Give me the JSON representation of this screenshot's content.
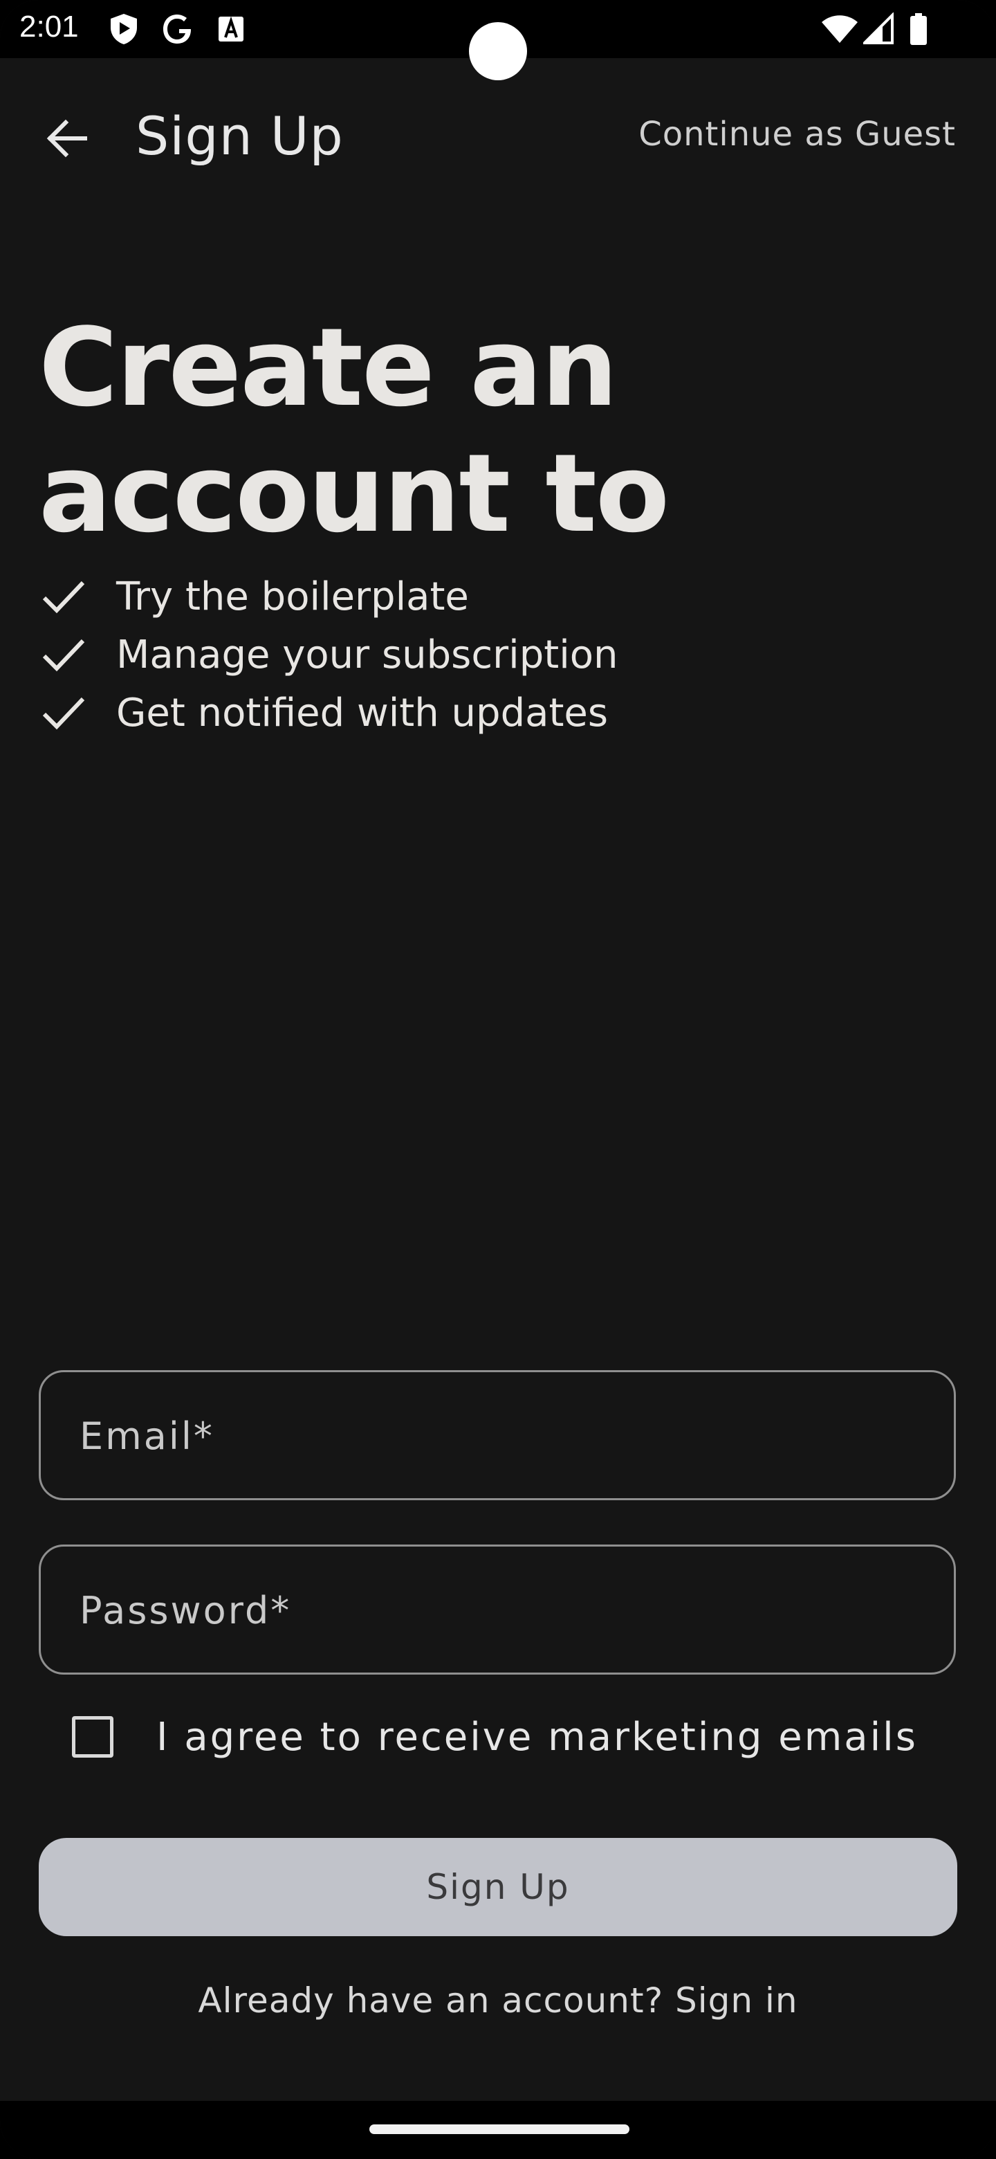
{
  "status_bar": {
    "time": "2:01",
    "icons": [
      "shield-play-icon",
      "google-icon",
      "font-a-icon",
      "wifi-icon",
      "signal-icon",
      "battery-icon"
    ]
  },
  "app_bar": {
    "title": "Sign Up",
    "back_icon": "arrow-back-icon",
    "guest_link": "Continue as Guest"
  },
  "hero": {
    "headline_line1": "Create an",
    "headline_line2": "account to",
    "benefits": [
      "Try the boilerplate",
      "Manage your subscription",
      "Get notified with updates"
    ]
  },
  "form": {
    "email_placeholder": "Email*",
    "email_value": "",
    "password_placeholder": "Password*",
    "password_value": "",
    "marketing_label": "I agree to receive marketing emails",
    "marketing_checked": false,
    "submit_label": "Sign Up",
    "signin_prompt": "Already have an account? Sign in"
  },
  "colors": {
    "background": "#151515",
    "text": "#e8e6e3",
    "button_bg": "#c1c3ca",
    "button_text": "#3a3a3c",
    "field_border": "#8f8f8f"
  }
}
